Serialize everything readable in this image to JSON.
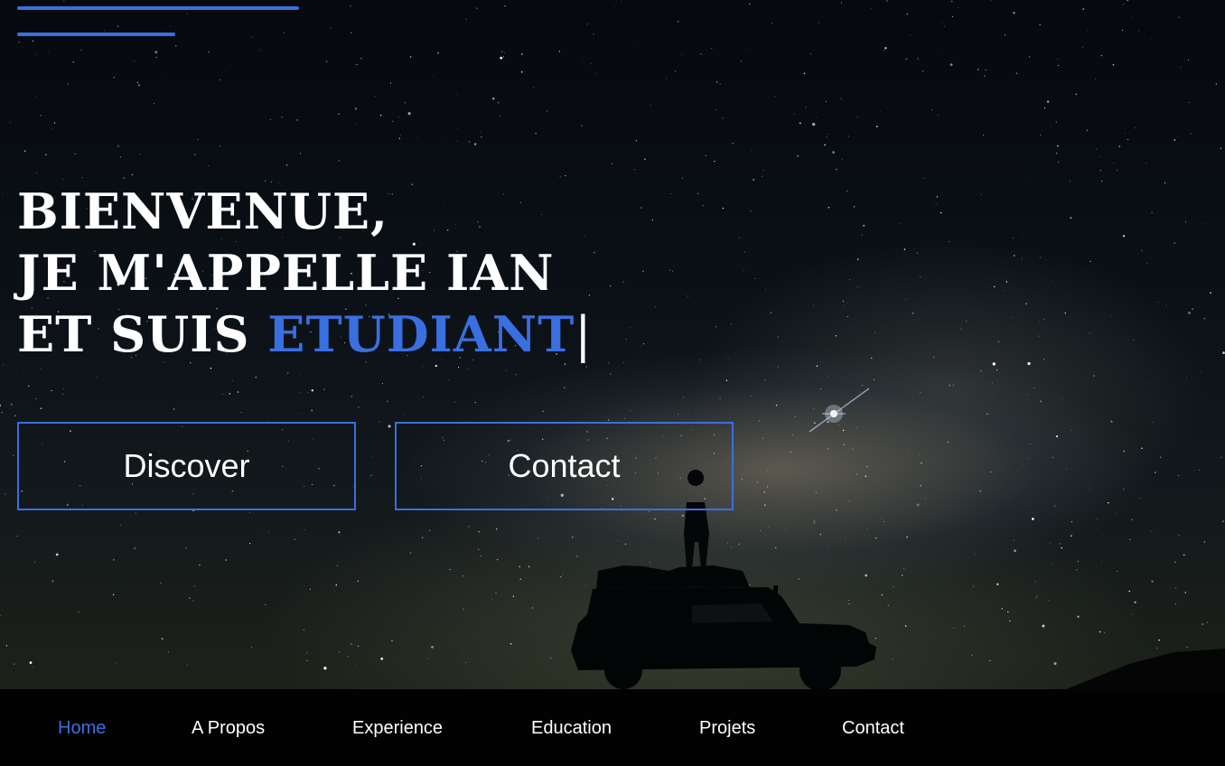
{
  "hero": {
    "headline": {
      "line1": "BIENVENUE,",
      "line2": "JE M'APPELLE IAN",
      "line3_prefix": "ET SUIS ",
      "line3_highlight": "ETUDIANT",
      "cursor": "|"
    },
    "buttons": {
      "discover": "Discover",
      "contact": "Contact"
    }
  },
  "nav": {
    "items": [
      {
        "label": "Home",
        "active": true
      },
      {
        "label": "A Propos",
        "active": false
      },
      {
        "label": "Experience",
        "active": false
      },
      {
        "label": "Education",
        "active": false
      },
      {
        "label": "Projets",
        "active": false
      },
      {
        "label": "Contact",
        "active": false
      }
    ]
  },
  "icons": {
    "menu": "hamburger-menu-icon"
  },
  "colors": {
    "accent": "#3a6fe0",
    "text": "#ffffff",
    "nav_background": "#030203"
  }
}
